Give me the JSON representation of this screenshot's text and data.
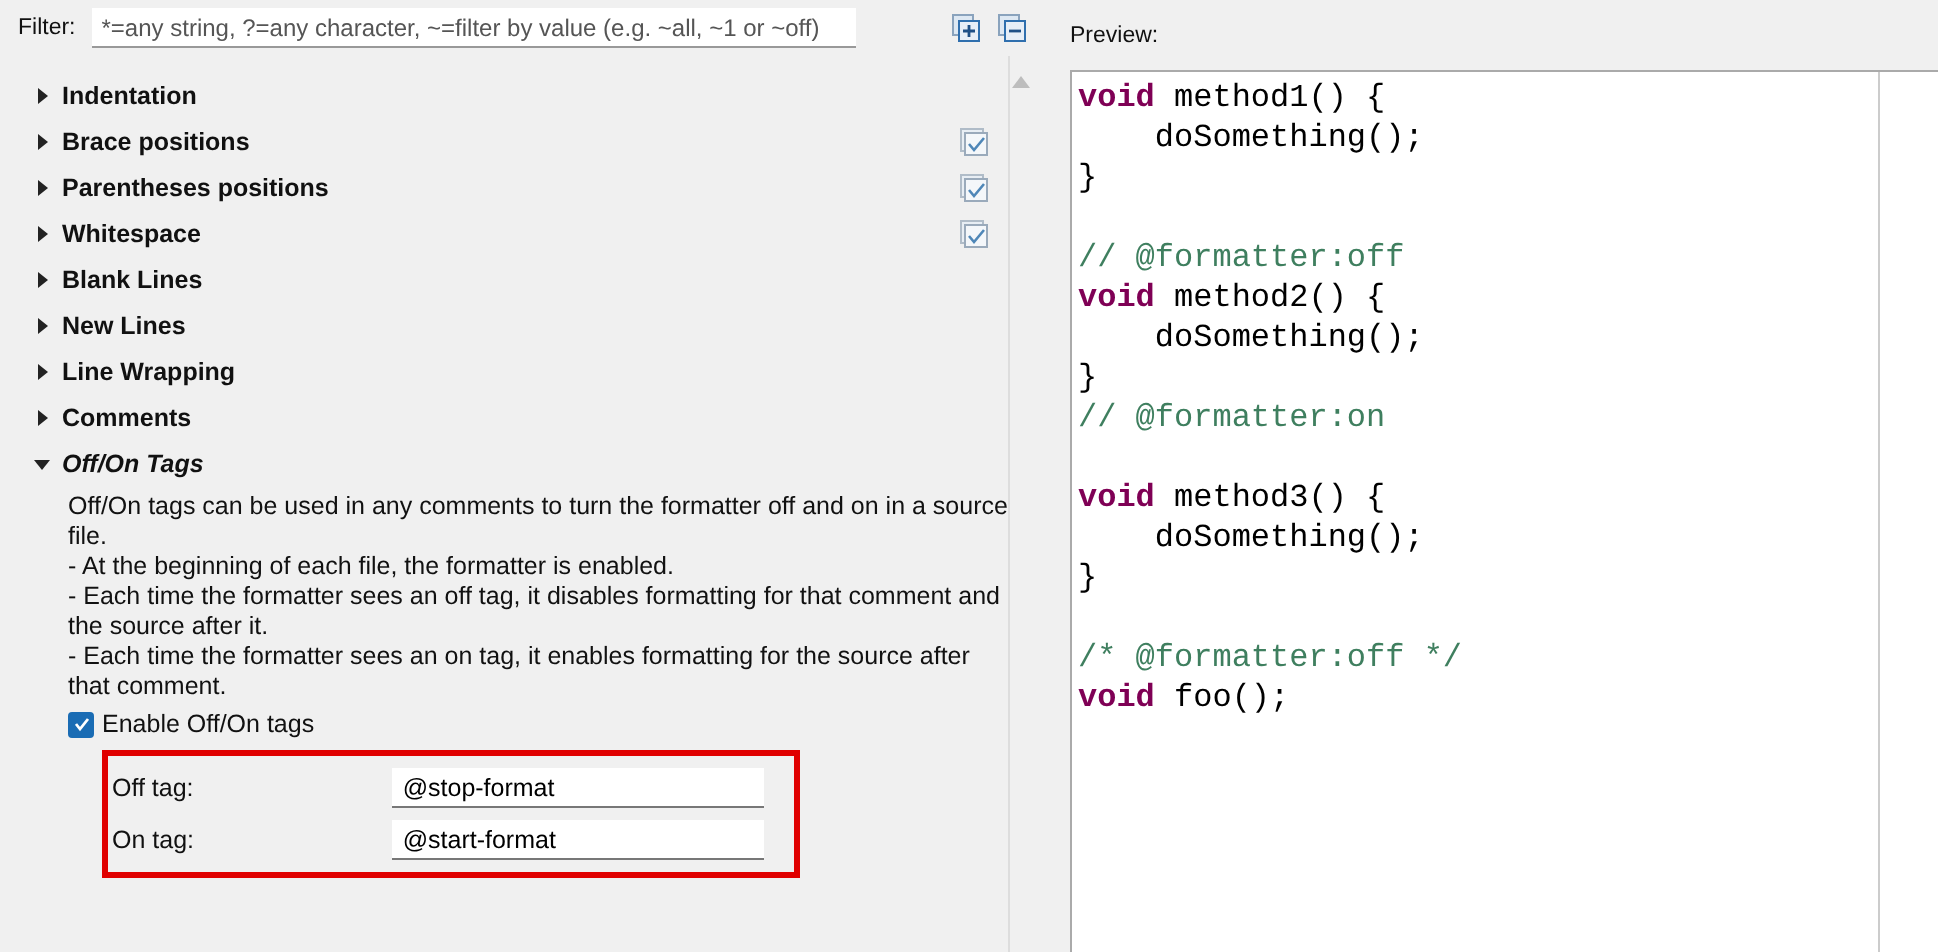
{
  "filter": {
    "label": "Filter:",
    "placeholder": "*=any string, ?=any character, ~=filter by value (e.g. ~all, ~1 or ~off)"
  },
  "sections": [
    {
      "label": "Indentation",
      "expanded": false,
      "kind": "plain"
    },
    {
      "label": "Brace positions",
      "expanded": false,
      "kind": "checkable",
      "checked": true
    },
    {
      "label": "Parentheses positions",
      "expanded": false,
      "kind": "checkable",
      "checked": true
    },
    {
      "label": "Whitespace",
      "expanded": false,
      "kind": "checkable",
      "checked": true
    },
    {
      "label": "Blank Lines",
      "expanded": false,
      "kind": "plain"
    },
    {
      "label": "New Lines",
      "expanded": false,
      "kind": "plain"
    },
    {
      "label": "Line Wrapping",
      "expanded": false,
      "kind": "plain"
    },
    {
      "label": "Comments",
      "expanded": false,
      "kind": "plain"
    },
    {
      "label": "Off/On Tags",
      "expanded": true,
      "kind": "plain"
    }
  ],
  "off_on_tags": {
    "description": [
      "Off/On tags can be used in any comments to turn the formatter off and on in a source file.",
      "- At the beginning of each file, the formatter is enabled.",
      "- Each time the formatter sees an off tag, it disables formatting for that comment and the source after it.",
      "- Each time the formatter sees an on tag, it enables formatting for the source after that comment."
    ],
    "enable": {
      "label": "Enable Off/On tags",
      "checked": true
    },
    "fields": [
      {
        "label": "Off tag:",
        "value": "@stop-format"
      },
      {
        "label": "On tag:",
        "value": "@start-format"
      }
    ]
  },
  "preview": {
    "label": "Preview:",
    "lines": [
      {
        "kind": "code",
        "tokens": [
          {
            "kind": "keyword",
            "text": "void"
          },
          {
            "kind": "plain",
            "text": " method1() {"
          }
        ]
      },
      {
        "kind": "code",
        "tokens": [
          {
            "kind": "plain",
            "text": "    doSomething();"
          }
        ]
      },
      {
        "kind": "code",
        "tokens": [
          {
            "kind": "plain",
            "text": "}"
          }
        ]
      },
      {
        "kind": "blank"
      },
      {
        "kind": "code",
        "tokens": [
          {
            "kind": "comment",
            "text": "// @formatter:off"
          }
        ]
      },
      {
        "kind": "code",
        "tokens": [
          {
            "kind": "keyword",
            "text": "void"
          },
          {
            "kind": "plain",
            "text": " method2() {"
          }
        ]
      },
      {
        "kind": "code",
        "tokens": [
          {
            "kind": "plain",
            "text": "    doSomething();"
          }
        ]
      },
      {
        "kind": "code",
        "tokens": [
          {
            "kind": "plain",
            "text": "}"
          }
        ]
      },
      {
        "kind": "code",
        "tokens": [
          {
            "kind": "comment",
            "text": "// @formatter:on"
          }
        ]
      },
      {
        "kind": "blank"
      },
      {
        "kind": "code",
        "tokens": [
          {
            "kind": "keyword",
            "text": "void"
          },
          {
            "kind": "plain",
            "text": " method3() {"
          }
        ]
      },
      {
        "kind": "code",
        "tokens": [
          {
            "kind": "plain",
            "text": "    doSomething();"
          }
        ]
      },
      {
        "kind": "code",
        "tokens": [
          {
            "kind": "plain",
            "text": "}"
          }
        ]
      },
      {
        "kind": "blank"
      },
      {
        "kind": "code",
        "tokens": [
          {
            "kind": "comment",
            "text": "/* @formatter:off */"
          }
        ]
      },
      {
        "kind": "code",
        "tokens": [
          {
            "kind": "keyword",
            "text": "void"
          },
          {
            "kind": "plain",
            "text": " foo();"
          }
        ]
      }
    ]
  }
}
